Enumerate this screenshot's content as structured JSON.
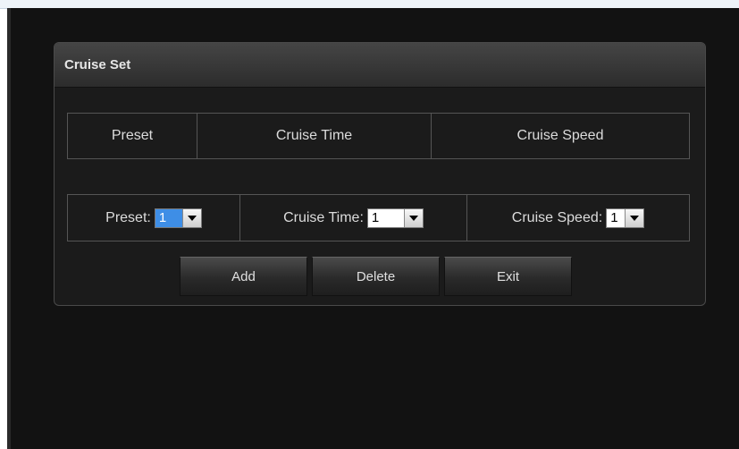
{
  "panel": {
    "title": "Cruise Set"
  },
  "list_header": {
    "columns": [
      "Preset",
      "Cruise Time",
      "Cruise Speed"
    ]
  },
  "controls": {
    "preset": {
      "label": "Preset:",
      "value": "1"
    },
    "cruise_time": {
      "label": "Cruise Time:",
      "value": "1"
    },
    "cruise_speed": {
      "label": "Cruise Speed:",
      "value": "1"
    }
  },
  "buttons": {
    "add": "Add",
    "delete": "Delete",
    "exit": "Exit"
  },
  "icons": {
    "dropdown_arrow": "chevron-down-icon"
  },
  "colors": {
    "background": "#121212",
    "panel": "#1b1b1b",
    "selection": "#3e8ee6",
    "text": "#dcdcdc"
  }
}
